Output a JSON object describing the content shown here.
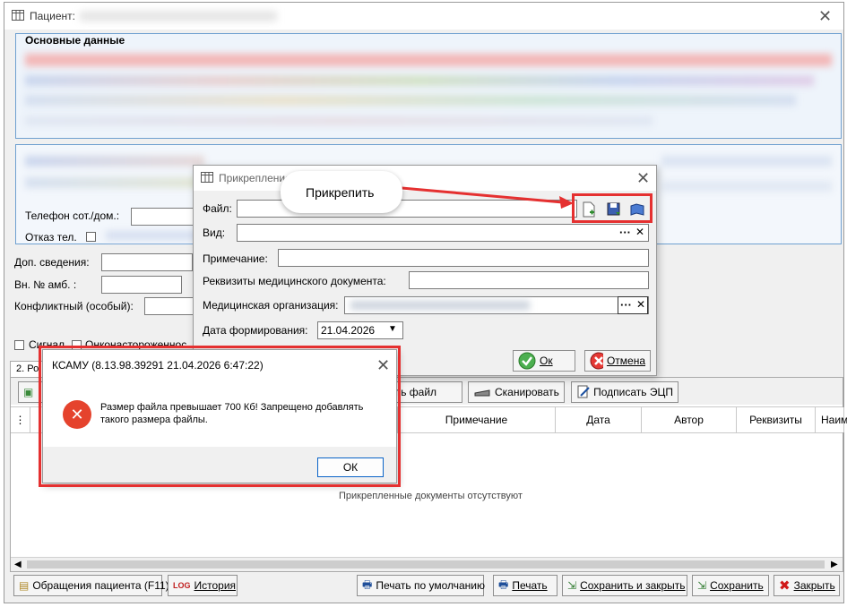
{
  "main_window": {
    "title": "Пациент:",
    "section_title": "Основные данные",
    "fields": {
      "phone_label": "Телефон сот./дом.:",
      "refusal_label": "Отказ тел.",
      "extra_info_label": "Доп. сведения:",
      "amb_number_label": "Вн. № амб. :",
      "conflict_label": "Конфликтный (особый):",
      "signal_label": "Сигнал",
      "onco_label": "Онконастороженнос"
    },
    "tab_label": "2. Ро",
    "toolbar": {
      "attach_file_label": "лить файл",
      "scan_label": "Сканировать",
      "sign_label": "Подписать ЭЦП"
    },
    "table": {
      "columns": [
        "Примечание",
        "Дата",
        "Автор",
        "Реквизиты",
        "Наим"
      ],
      "empty_text": "Прикрепленные документы отсутствуют"
    },
    "bottom_buttons": {
      "appeals": "Обращения пациента (F11)",
      "history": "История",
      "print_default": "Печать по умолчанию",
      "print": "Печать",
      "save_close": "Сохранить и закрыть",
      "save": "Сохранить",
      "close": "Закрыть"
    }
  },
  "attach_dialog": {
    "title": "Прикрепление",
    "file_label": "Файл:",
    "type_label": "Вид:",
    "note_label": "Примечание:",
    "requisites_label": "Реквизиты медицинского документа:",
    "org_label": "Медицинская организация:",
    "date_label": "Дата формирования:",
    "date_value": "21.04.2026",
    "ok_label": "Ок",
    "cancel_label": "Отмена"
  },
  "callout": {
    "text": "Прикрепить"
  },
  "error_dialog": {
    "title": "КСАМУ (8.13.98.39291 21.04.2026 6:47:22)",
    "message_line1": "Размер файла превышает 700 Кб! Запрещено добавлять",
    "message_line2": "такого размера файлы.",
    "ok_label": "ОК"
  },
  "colors": {
    "highlight_red": "#e53030",
    "error_icon": "#e5432d",
    "window_bg": "#f0f0f0"
  }
}
